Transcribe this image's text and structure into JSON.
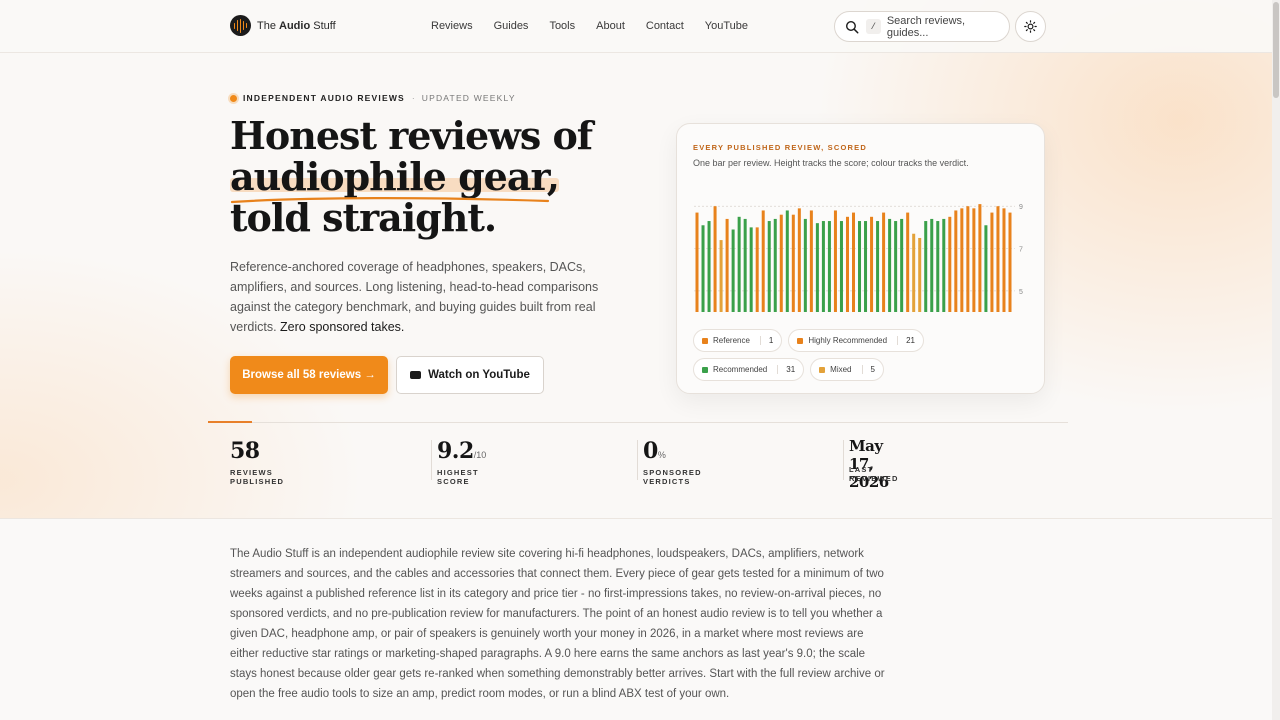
{
  "brand": {
    "prefix": "The ",
    "bold": "Audio",
    "suffix": " Stuff"
  },
  "nav": [
    "Reviews",
    "Guides",
    "Tools",
    "About",
    "Contact",
    "YouTube"
  ],
  "search": {
    "shortcut": "/",
    "placeholder": "Search reviews, guides..."
  },
  "hero": {
    "eyebrow_primary": "INDEPENDENT AUDIO REVIEWS",
    "eyebrow_sep": "·",
    "eyebrow_secondary": "UPDATED WEEKLY",
    "headline_line1": "Honest reviews of",
    "headline_line2": "audiophile gear,",
    "headline_line3": "told straight.",
    "lede": "Reference-anchored coverage of headphones, speakers, DACs, amplifiers, and sources. Long listening, head-to-head comparisons against the category benchmark, and buying guides built from real verdicts. ",
    "lede_strong": "Zero sponsored takes.",
    "primary_button": "Browse all 58 reviews →",
    "secondary_button": "Watch on YouTube"
  },
  "card": {
    "eyebrow": "EVERY PUBLISHED REVIEW, SCORED",
    "subtitle": "One bar per review. Height tracks the score; colour tracks the verdict.",
    "legend": [
      {
        "label": "Reference",
        "count": "1",
        "color": "#e8821c"
      },
      {
        "label": "Highly Recommended",
        "count": "21",
        "color": "#e8821c"
      },
      {
        "label": "Recommended",
        "count": "31",
        "color": "#3aa04a"
      },
      {
        "label": "Mixed",
        "count": "5",
        "color": "#e3a23a"
      }
    ]
  },
  "chart_data": {
    "type": "bar",
    "ylim": [
      4,
      9.2
    ],
    "ytick_labels": [
      "9",
      "7",
      "5"
    ],
    "yticks": [
      9,
      7,
      5
    ],
    "reference_line": 9,
    "colors": {
      "H": "#e8821c",
      "R": "#3aa04a",
      "M": "#e3a23a",
      "X": "#e8821c"
    },
    "values": [
      8.7,
      8.1,
      8.3,
      9.0,
      7.4,
      8.4,
      7.9,
      8.5,
      8.4,
      8.0,
      8.0,
      8.8,
      8.3,
      8.4,
      8.6,
      8.8,
      8.6,
      8.9,
      8.4,
      8.8,
      8.2,
      8.3,
      8.3,
      8.8,
      8.3,
      8.5,
      8.7,
      8.3,
      8.3,
      8.5,
      8.3,
      8.7,
      8.4,
      8.3,
      8.4,
      8.7,
      7.7,
      7.5,
      8.3,
      8.4,
      8.3,
      8.4,
      8.5,
      8.8,
      8.9,
      9.0,
      8.9,
      9.1,
      8.1,
      8.7,
      9.0,
      8.9,
      8.7
    ],
    "verdicts": [
      "H",
      "R",
      "R",
      "H",
      "M",
      "H",
      "R",
      "R",
      "R",
      "R",
      "H",
      "H",
      "R",
      "R",
      "H",
      "R",
      "H",
      "H",
      "R",
      "H",
      "R",
      "R",
      "R",
      "H",
      "R",
      "H",
      "H",
      "R",
      "R",
      "H",
      "R",
      "H",
      "R",
      "R",
      "R",
      "H",
      "M",
      "M",
      "R",
      "R",
      "R",
      "R",
      "H",
      "H",
      "H",
      "X",
      "H",
      "H",
      "R",
      "H",
      "H",
      "H",
      "H"
    ]
  },
  "stats": [
    {
      "value": "58",
      "unit": "",
      "label": "REVIEWS PUBLISHED"
    },
    {
      "value": "9.2",
      "unit": "/10",
      "label": "HIGHEST SCORE"
    },
    {
      "value": "0",
      "unit": "%",
      "label": "SPONSORED VERDICTS"
    },
    {
      "value": "May 17, 2026",
      "unit": "",
      "label": "LAST REVIEWED"
    }
  ],
  "about": "The Audio Stuff is an independent audiophile review site covering hi-fi headphones, loudspeakers, DACs, amplifiers, network streamers and sources, and the cables and accessories that connect them. Every piece of gear gets tested for a minimum of two weeks against a published reference list in its category and price tier - no first-impressions takes, no review-on-arrival pieces, no sponsored verdicts, and no pre-publication review for manufacturers. The point of an honest audio review is to tell you whether a given DAC, headphone amp, or pair of speakers is genuinely worth your money in 2026, in a market where most reviews are either reductive star ratings or marketing-shaped paragraphs. A 9.0 here earns the same anchors as last year's 9.0; the scale stays honest because older gear gets re-ranked when something demonstrably better arrives. Start with the full review archive or open the free audio tools to size an amp, predict room modes, or run a blind ABX test of your own."
}
